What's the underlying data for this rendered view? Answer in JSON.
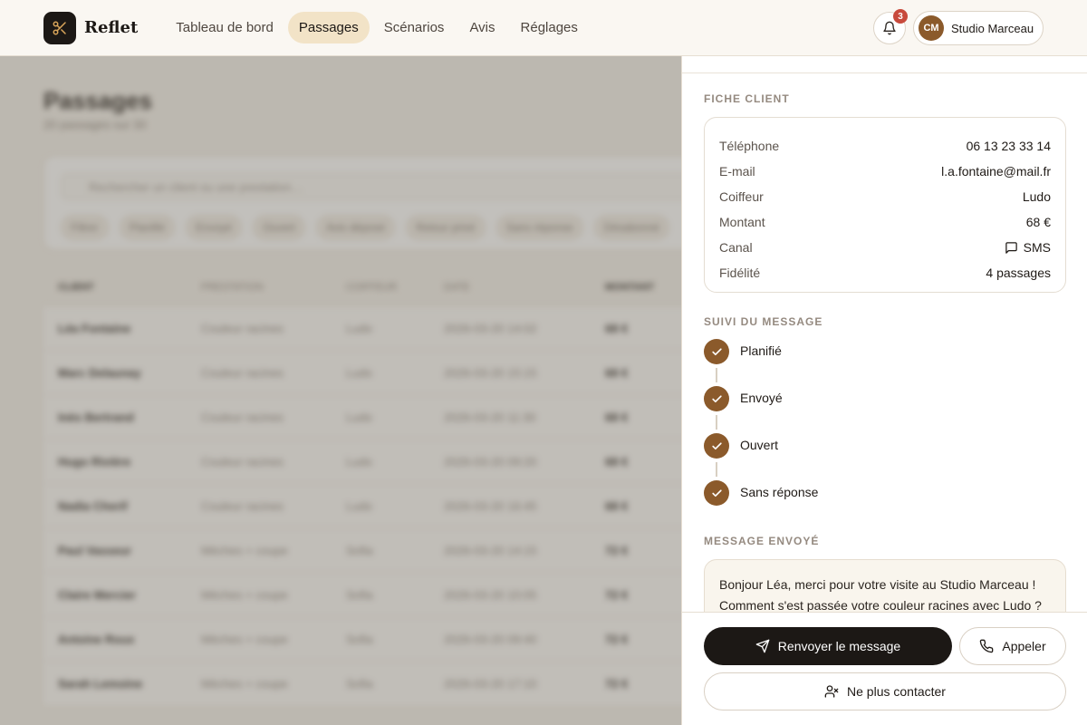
{
  "header": {
    "brand": "Reflet",
    "nav": [
      {
        "label": "Tableau de bord"
      },
      {
        "label": "Passages"
      },
      {
        "label": "Scénarios"
      },
      {
        "label": "Avis"
      },
      {
        "label": "Réglages"
      }
    ],
    "active_nav": "Passages",
    "notifications_count": "3",
    "account": {
      "initials": "CM",
      "name": "Studio Marceau"
    }
  },
  "background": {
    "title": "Passages",
    "subtitle": "20 passages sur 30",
    "search_placeholder": "Rechercher un client ou une prestation…",
    "filter_chips": [
      "Filtrer",
      "Planifié",
      "Envoyé",
      "Ouvert",
      "Avis déposé",
      "Retour privé",
      "Sans réponse",
      "Désabonné"
    ],
    "columns": [
      "CLIENT",
      "PRESTATION",
      "COIFFEUR",
      "DATE",
      "MONTANT"
    ],
    "rows": [
      {
        "client": "Léa Fontaine",
        "prestation": "Couleur racines",
        "coiffeur": "Ludo",
        "date": "2026-03-20 14:02",
        "montant": "68 €"
      },
      {
        "client": "Marc Delaunay",
        "prestation": "Couleur racines",
        "coiffeur": "Ludo",
        "date": "2026-03-20 15:15",
        "montant": "68 €"
      },
      {
        "client": "Inès Bertrand",
        "prestation": "Couleur racines",
        "coiffeur": "Ludo",
        "date": "2026-03-20 11:30",
        "montant": "68 €"
      },
      {
        "client": "Hugo Rivière",
        "prestation": "Couleur racines",
        "coiffeur": "Ludo",
        "date": "2026-03-20 09:20",
        "montant": "68 €"
      },
      {
        "client": "Nadia Cherif",
        "prestation": "Couleur racines",
        "coiffeur": "Ludo",
        "date": "2026-03-20 16:45",
        "montant": "68 €"
      },
      {
        "client": "Paul Vasseur",
        "prestation": "Mèches + coupe",
        "coiffeur": "Sofia",
        "date": "2026-03-20 14:15",
        "montant": "72 €"
      },
      {
        "client": "Claire Mercier",
        "prestation": "Mèches + coupe",
        "coiffeur": "Sofia",
        "date": "2026-03-20 10:05",
        "montant": "72 €"
      },
      {
        "client": "Antoine Roux",
        "prestation": "Mèches + coupe",
        "coiffeur": "Sofia",
        "date": "2026-03-20 09:40",
        "montant": "72 €"
      },
      {
        "client": "Sarah Lemoine",
        "prestation": "Mèches + coupe",
        "coiffeur": "Sofia",
        "date": "2026-03-20 17:10",
        "montant": "72 €"
      }
    ]
  },
  "drawer": {
    "client_section_title": "FICHE CLIENT",
    "client_info": [
      {
        "label": "Téléphone",
        "value": "06 13 23 33 14",
        "icon": ""
      },
      {
        "label": "E-mail",
        "value": "l.a.fontaine@mail.fr",
        "icon": ""
      },
      {
        "label": "Coiffeur",
        "value": "Ludo",
        "icon": ""
      },
      {
        "label": "Montant",
        "value": "68 €",
        "icon": ""
      },
      {
        "label": "Canal",
        "value": "SMS",
        "icon": "message-icon"
      },
      {
        "label": "Fidélité",
        "value": "4 passages",
        "icon": ""
      }
    ],
    "tracking_section_title": "SUIVI DU MESSAGE",
    "steps": [
      {
        "label": "Planifié"
      },
      {
        "label": "Envoyé"
      },
      {
        "label": "Ouvert"
      },
      {
        "label": "Sans réponse"
      }
    ],
    "message_section_title": "MESSAGE ENVOYÉ",
    "message_text": "Bonjour Léa, merci pour votre visite au Studio Marceau ! Comment s'est passée votre couleur racines avec Ludo ?",
    "actions": {
      "resend": "Renvoyer le message",
      "call": "Appeler",
      "stop": "Ne plus contacter"
    }
  },
  "colors": {
    "accent": "#8b5a2b",
    "primary_button": "#1c1815",
    "badge": "#c84a3c",
    "nav_active_bg": "#f2e3c7"
  }
}
